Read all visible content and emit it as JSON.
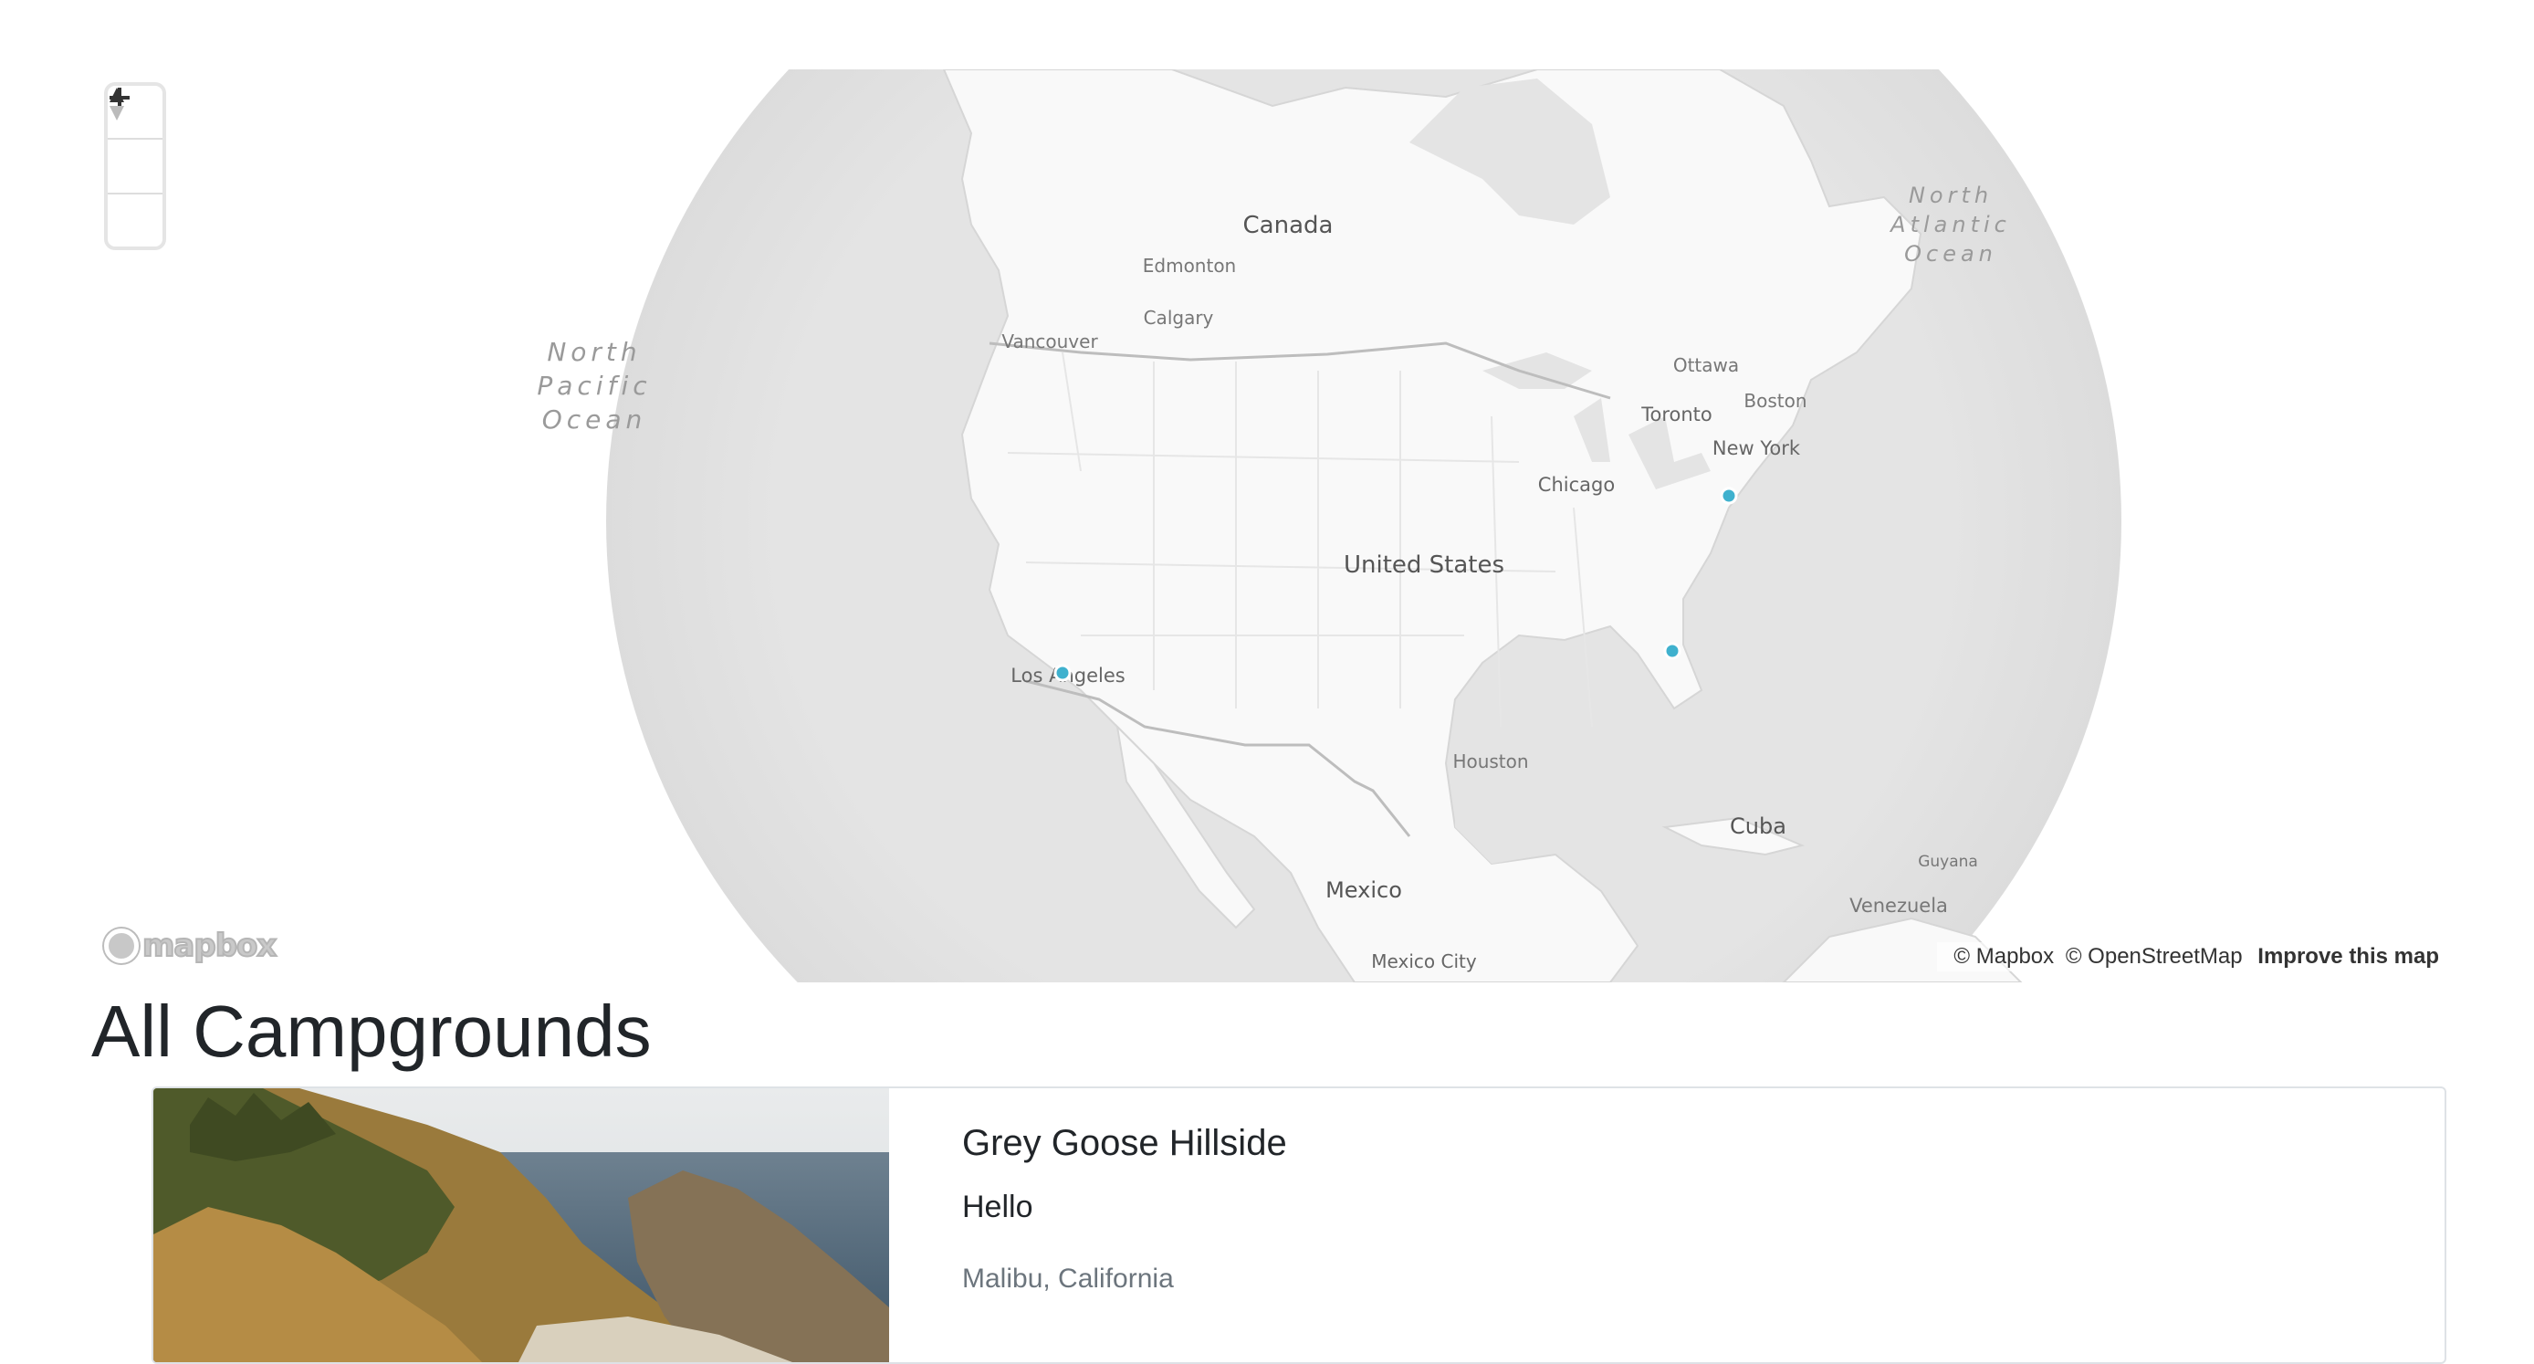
{
  "map": {
    "controls": {
      "zoom_in_label": "+",
      "zoom_out_label": "−",
      "compass_label": "reset bearing"
    },
    "labels": {
      "north_pacific": [
        "North",
        "Pacific",
        "Ocean"
      ],
      "north_atlantic": [
        "North",
        "Atlantic",
        "Ocean"
      ],
      "canada": "Canada",
      "edmonton": "Edmonton",
      "calgary": "Calgary",
      "vancouver": "Vancouver",
      "ottawa": "Ottawa",
      "boston": "Boston",
      "toronto": "Toronto",
      "new_york": "New York",
      "chicago": "Chicago",
      "united_states": "United States",
      "los_angeles": "Los Angeles",
      "houston": "Houston",
      "cuba": "Cuba",
      "guyana": "Guyana",
      "venezuela": "Venezuela",
      "mexico": "Mexico",
      "mexico_city": "Mexico City"
    },
    "markers": [
      "Los Angeles area marker",
      "Virginia marker",
      "Georgia marker"
    ],
    "marker_color": "#3fb1ce",
    "logo_text": "mapbox",
    "attribution": {
      "mapbox": "© Mapbox",
      "osm": "© OpenStreetMap",
      "improve": "Improve this map"
    }
  },
  "page": {
    "heading": "All Campgrounds"
  },
  "campgrounds": [
    {
      "title": "Grey Goose Hillside",
      "description": "Hello",
      "location": "Malibu, California"
    }
  ]
}
